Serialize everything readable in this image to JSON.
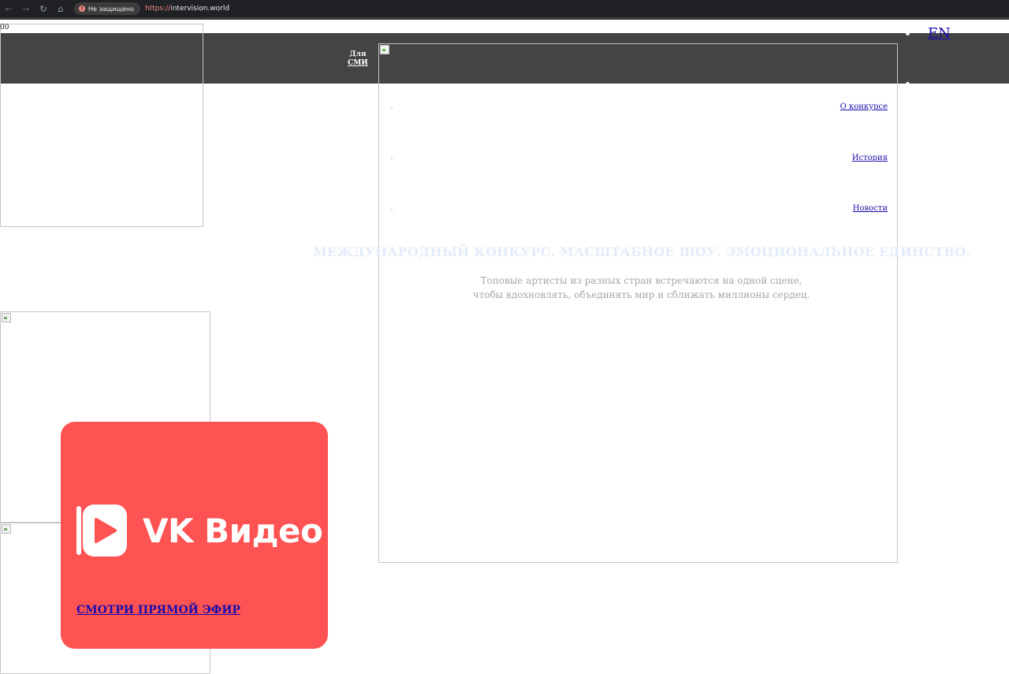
{
  "browser": {
    "security_label": "Не защищено",
    "url_protocol": "https://",
    "url_host": "intervision.world"
  },
  "header": {
    "press_label_line1": "Для",
    "press_label_line2": "СМИ",
    "logo_glyph": "00"
  },
  "lang": {
    "items": [
      "EN",
      ""
    ]
  },
  "menu": {
    "items": [
      "О конкурсе",
      "История",
      "Новости"
    ]
  },
  "hero": {
    "title": "МЕЖДУНАРОДНЫЙ КОНКУРС. МАСШТАБНОЕ ШОУ. ЭМОЦИОНАЛЬНОЕ ЕДИНСТВО.",
    "subtitle_line1": "Топовые артисты из разных стран встречаются на одной сцене,",
    "subtitle_line2": "чтобы вдохновлять, объединять мир и сближать миллионы сердец."
  },
  "promo": {
    "brand": "VK Видео",
    "cta": "СМОТРИ ПРЯМОЙ ЭФИР",
    "colors": {
      "card": "#ff5252",
      "link": "#1a0dab"
    }
  }
}
